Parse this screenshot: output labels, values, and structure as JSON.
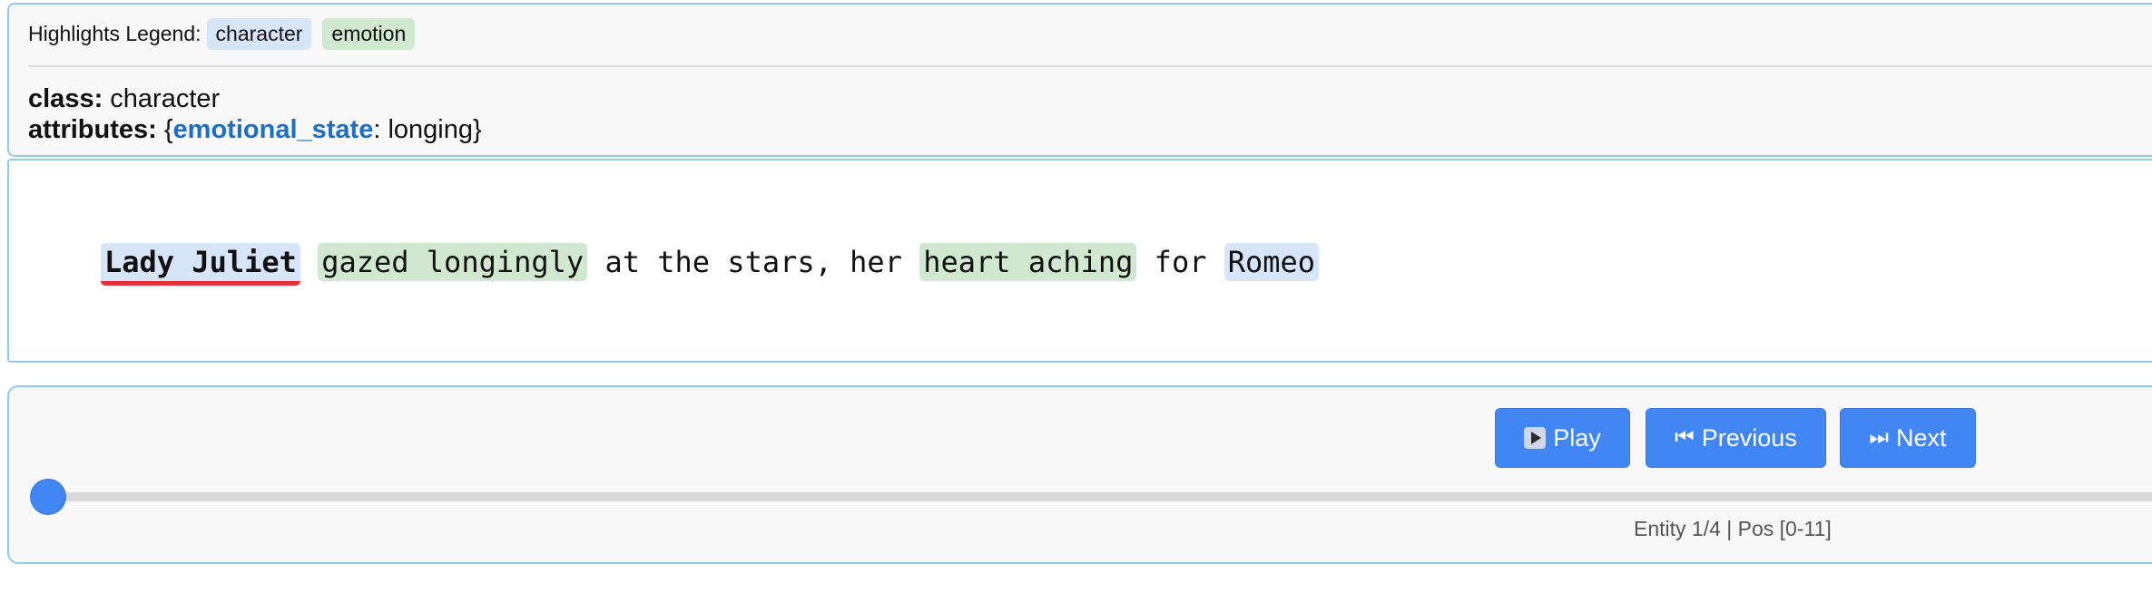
{
  "legend": {
    "title": "Highlights Legend:",
    "items": [
      {
        "label": "character",
        "color": "#d6e5f8"
      },
      {
        "label": "emotion",
        "color": "#cfe8cf"
      }
    ]
  },
  "info": {
    "class_label": "class:",
    "class_value": "character",
    "attributes_label": "attributes:",
    "attr_open": "{",
    "attr_key": "emotional_state",
    "attr_sep": ": ",
    "attr_value": "longing",
    "attr_close": "}"
  },
  "text": {
    "segments": [
      {
        "text": "Lady Juliet",
        "class": "character",
        "active": true
      },
      {
        "text": " ",
        "class": null
      },
      {
        "text": "gazed longingly",
        "class": "emotion"
      },
      {
        "text": " at the stars, her ",
        "class": null
      },
      {
        "text": "heart aching",
        "class": "emotion"
      },
      {
        "text": " for ",
        "class": null
      },
      {
        "text": "Romeo",
        "class": "character"
      }
    ],
    "active_underline_color": "#e2303b"
  },
  "controls": {
    "play_label": "Play",
    "previous_label": "Previous",
    "next_label": "Next",
    "previous_icon": "⏮",
    "next_icon": "⏭",
    "progress": 0.0,
    "status": "Entity 1/4 | Pos [0-11]",
    "accent_color": "#4286f4"
  }
}
